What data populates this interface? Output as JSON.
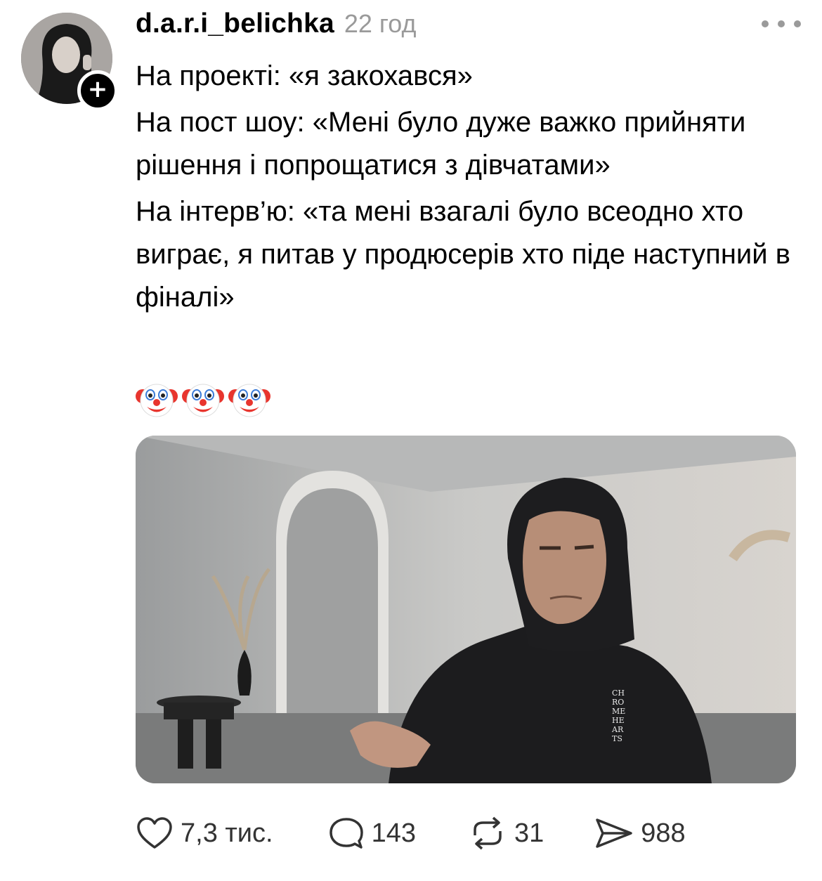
{
  "post": {
    "username": "d.a.r.i_belichka",
    "time": "22 год",
    "follow_symbol": "+",
    "lines": [
      "На проекті: «я закохався»",
      "На пост шоу: «Мені було дуже важко прийняти рішення і попрощатися з дівчатами»",
      "На інтерв’ю: «та мені взагалі було всеодно хто виграє, я питав у продюсерів хто піде наступний в фіналі»"
    ],
    "emoji": [
      "clown-face-icon",
      "clown-face-icon",
      "clown-face-icon"
    ]
  },
  "media": {
    "hoodie_print": "CH\nRO\nME\nHE\nAR\nTS"
  },
  "actions": {
    "likes": "7,3 тис.",
    "replies": "143",
    "reposts": "31",
    "shares": "988"
  },
  "colors": {
    "text": "#000000",
    "muted": "#9a9a9a",
    "icon": "#333333",
    "clown_face": "#ffffff",
    "clown_hair": "#e8352e"
  }
}
